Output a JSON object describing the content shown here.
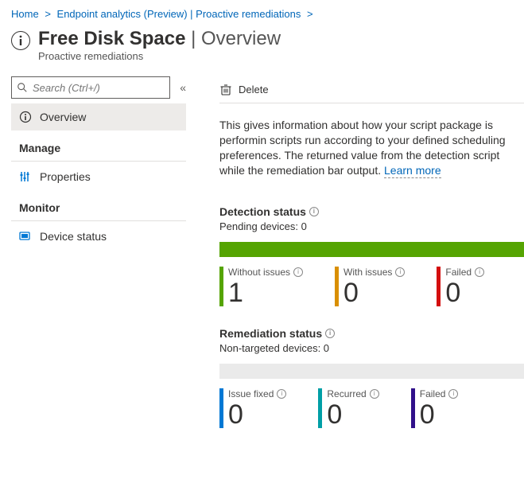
{
  "breadcrumbs": {
    "home": "Home",
    "analytics": "Endpoint analytics (Preview) | Proactive remediations"
  },
  "header": {
    "title_main": "Free Disk Space",
    "title_sub": "Overview",
    "subtitle": "Proactive remediations"
  },
  "sidebar": {
    "search_placeholder": "Search (Ctrl+/)",
    "overview": "Overview",
    "manage_label": "Manage",
    "properties": "Properties",
    "monitor_label": "Monitor",
    "device_status": "Device status"
  },
  "toolbar": {
    "delete": "Delete"
  },
  "intro": {
    "text": "This gives information about how your script package is performin scripts run according to your defined scheduling preferences. The returned value from the detection script while the remediation bar output.",
    "learn_more": "Learn more"
  },
  "detection": {
    "title": "Detection status",
    "pending_label": "Pending devices: 0",
    "bar_color": "#55a402",
    "cards": [
      {
        "label": "Without issues",
        "value": "1",
        "color": "#55a402"
      },
      {
        "label": "With issues",
        "value": "0",
        "color": "#d98f00"
      },
      {
        "label": "Failed",
        "value": "0",
        "color": "#d40f0f"
      }
    ]
  },
  "remediation": {
    "title": "Remediation status",
    "nontarget_label": "Non-targeted devices: 0",
    "bar_color": "#eaeaea",
    "cards": [
      {
        "label": "Issue fixed",
        "value": "0",
        "color": "#0078d4"
      },
      {
        "label": "Recurred",
        "value": "0",
        "color": "#009fa6"
      },
      {
        "label": "Failed",
        "value": "0",
        "color": "#30108a"
      }
    ]
  },
  "chart_data": [
    {
      "type": "bar",
      "title": "Detection status",
      "categories": [
        "Without issues",
        "With issues",
        "Failed"
      ],
      "values": [
        1,
        0,
        0
      ],
      "extra": {
        "Pending devices": 0
      }
    },
    {
      "type": "bar",
      "title": "Remediation status",
      "categories": [
        "Issue fixed",
        "Recurred",
        "Failed"
      ],
      "values": [
        0,
        0,
        0
      ],
      "extra": {
        "Non-targeted devices": 0
      }
    }
  ]
}
